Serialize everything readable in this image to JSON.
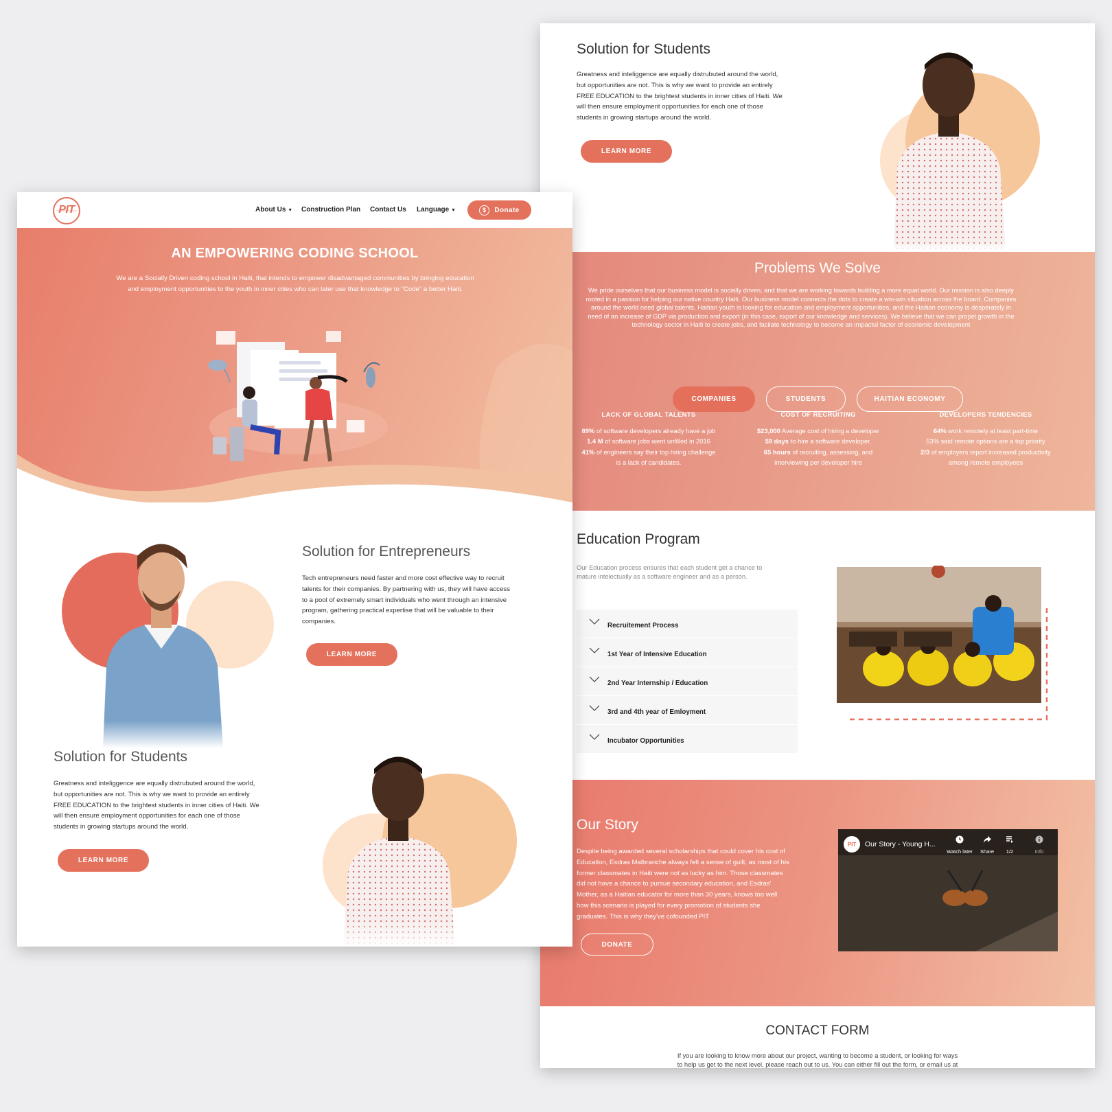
{
  "front": {
    "nav": {
      "logo_text": "PIT",
      "items": [
        "About Us",
        "Construction Plan",
        "Contact Us",
        "Language"
      ],
      "donate_label": "Donate",
      "dollar_symbol": "$"
    },
    "hero": {
      "title": "AN EMPOWERING CODING SCHOOL",
      "text_line1": "We are  a Socially Driven coding school in Haiti, that intends to empower disadvantaged communities by bringing education",
      "text_line2": "and employment opportunities to the youth in inner cities who can later use that knowledge to \"Code\" a better Haiti."
    },
    "entrepreneurs": {
      "title": "Solution for Entrepreneurs",
      "lines": [
        "Tech entrepreneurs need faster and more cost effective way to recruit",
        "talents for their companies. By partnering with us, they will have access",
        "to a pool of extremely smart individuals who went through an intensive",
        "program, gathering practical expertise that will be valuable to their",
        "companies."
      ],
      "button": "LEARN MORE"
    },
    "students": {
      "title": "Solution for Students",
      "lines": [
        "Greatness and inteliggence are equally distrubuted around the world,",
        "but opportunities are not. This is why we want to provide an entirely",
        "FREE EDUCATION to the brightest students in inner cities of Haiti. We",
        "will then ensure employment opportunities for each one of those",
        "students in growing startups around the world."
      ],
      "button": "LEARN MORE"
    }
  },
  "back": {
    "students": {
      "title": "Solution for Students",
      "lines": [
        "Greatness and inteliggence are equally distrubuted around the world,",
        "but opportunities are not. This is why we want to provide an entirely",
        "FREE EDUCATION to the brightest students in inner cities of Haiti. We",
        "will then ensure employment opportunities for each one of those",
        "students in growing startups around the world."
      ],
      "button": "LEARN MORE"
    },
    "problems": {
      "title": "Problems We Solve",
      "lines": [
        "We pride ourselves that our business model is socially driven, and that we are working towards building a more equal world. Our mission is also deeply",
        "rooted in a passion for helping our native country Haiti. Our business model connects the dots to create a win-win situation across the board. Companies",
        "around the world need global talents, Haitian youth is looking for education and employment opportunities, and the Haitian economy is desperately in",
        "need of an increase of GDP via production and export (in this case, export of our knowledge and services). We believe that we can propel growth in the",
        "technology sector in Haiti to create jobs, and facilate technology to become an impactul factor of economic development"
      ],
      "tabs": [
        "COMPANIES",
        "STUDENTS",
        "HAITIAN ECONOMY"
      ],
      "columns": [
        {
          "title": "LACK OF GLOBAL TALENTS",
          "lines": [
            [
              "89%",
              " of software developers already have a job"
            ],
            [
              "1.4 M",
              " of software jobs went unfilled in 2016"
            ],
            [
              "41%",
              " of engineers say their top hiring challenge"
            ],
            [
              "",
              "is a lack of candidates."
            ]
          ]
        },
        {
          "title": "COST OF RECRUITING",
          "lines": [
            [
              "$23,000",
              " Average cost of hiring a developer"
            ],
            [
              "59 days",
              " to hire a software developer."
            ],
            [
              "65 hours",
              " of recruiting, assessing, and"
            ],
            [
              "",
              "interviewing per developer hire"
            ]
          ]
        },
        {
          "title": "DEVELOPERS TENDENCIES",
          "lines": [
            [
              "64%",
              "  work remotely at least part-time"
            ],
            [
              "",
              "53% said remote options are a top priority"
            ],
            [
              "2/3",
              " of employers report increased productivity"
            ],
            [
              "",
              "among remote employees"
            ]
          ]
        }
      ]
    },
    "education": {
      "title": "Education Program",
      "intro_line1": "Our Education process ensures that each student get a chance to",
      "intro_line2": "mature intelectually as a software engineer and as a person.",
      "items": [
        "Recruitement Process",
        "1st Year of Intensive Education",
        "2nd Year Internship / Education",
        "3rd and 4th year of Emloyment",
        "Incubator Opportunities"
      ]
    },
    "story": {
      "title": "Our Story",
      "lines": [
        "Despite being awarded several scholarships that could cover his cost of",
        "Education, Esdras Malbranche always felt a sense of guilt, as most of his",
        "former classmates in Haiti were not as lucky as him. Those classmates",
        "did not have a chance to pursue secondary education, and Esdras'",
        "Mother, as a Haitian educator for more than 30 years, knows too well",
        "how this scenario is played for every promotion of students she",
        "graduates. This is why they've cofounded PIT"
      ],
      "button": "DONATE",
      "video": {
        "title": "Our Story - Young H...",
        "channel_logo": "PIT",
        "actions": [
          "Watch later",
          "Share",
          "1/2",
          "Info"
        ]
      }
    },
    "contact": {
      "title": "CONTACT FORM",
      "line1": "If you are looking to know more about our project, wanting to become a student, or looking for ways",
      "line2": "to help us get to the next level, please reach out to us. You can either fill out the form, or email us at"
    }
  },
  "colors": {
    "accent": "#e4715c",
    "peach": "#f7c79c",
    "light_peach": "#fde3cc",
    "dark_red": "#de6a57"
  }
}
